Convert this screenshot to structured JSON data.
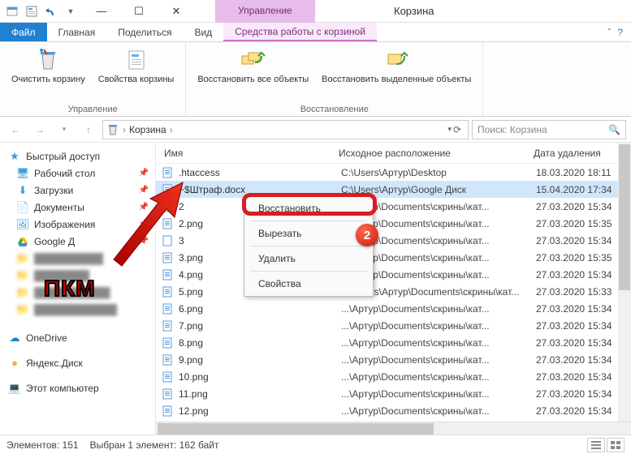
{
  "title": "Корзина",
  "tab_top": "Управление",
  "ribbon": {
    "file": "Файл",
    "tabs": [
      "Главная",
      "Поделиться",
      "Вид"
    ],
    "contextual": "Средства работы с корзиной",
    "group1": {
      "title": "Управление",
      "btn1": "Очистить корзину",
      "btn2": "Свойства корзины"
    },
    "group2": {
      "title": "Восстановление",
      "btn1": "Восстановить все объекты",
      "btn2": "Восстановить выделенные объекты"
    }
  },
  "breadcrumb": {
    "item": "Корзина"
  },
  "search": {
    "placeholder": "Поиск: Корзина"
  },
  "sidebar": {
    "quick": "Быстрый доступ",
    "items": [
      {
        "label": "Рабочий стол",
        "pinned": true
      },
      {
        "label": "Загрузки",
        "pinned": true
      },
      {
        "label": "Документы",
        "pinned": true
      },
      {
        "label": "Изображения",
        "pinned": true
      },
      {
        "label": "Google Д",
        "pinned": true
      }
    ],
    "onedrive": "OneDrive",
    "yandex": "Яндекс.Диск",
    "thispc": "Этот компьютер"
  },
  "columns": {
    "name": "Имя",
    "loc": "Исходное расположение",
    "date": "Дата удаления"
  },
  "files": [
    {
      "name": ".htaccess",
      "loc": "C:\\Users\\Артур\\Desktop",
      "date": "18.03.2020 18:11"
    },
    {
      "name": "~$Штраф.docx",
      "loc": "C:\\Users\\Артур\\Google Диск",
      "date": "15.04.2020 17:34",
      "selected": true
    },
    {
      "name": "2",
      "loc": "...\\Артур\\Documents\\скрины\\кат...",
      "date": "27.03.2020 15:34"
    },
    {
      "name": "2.png",
      "loc": "...\\Артур\\Documents\\скрины\\кат...",
      "date": "27.03.2020 15:35"
    },
    {
      "name": "3",
      "loc": "...\\Артур\\Documents\\скрины\\кат...",
      "date": "27.03.2020 15:34"
    },
    {
      "name": "3.png",
      "loc": "...\\Артур\\Documents\\скрины\\кат...",
      "date": "27.03.2020 15:35"
    },
    {
      "name": "4.png",
      "loc": "...\\Артур\\Documents\\скрины\\кат...",
      "date": "27.03.2020 15:34"
    },
    {
      "name": "5.png",
      "loc": "C:\\Users\\Артур\\Documents\\скрины\\кат...",
      "date": "27.03.2020 15:33"
    },
    {
      "name": "6.png",
      "loc": "...\\Артур\\Documents\\скрины\\кат...",
      "date": "27.03.2020 15:34"
    },
    {
      "name": "7.png",
      "loc": "...\\Артур\\Documents\\скрины\\кат...",
      "date": "27.03.2020 15:34"
    },
    {
      "name": "8.png",
      "loc": "...\\Артур\\Documents\\скрины\\кат...",
      "date": "27.03.2020 15:34"
    },
    {
      "name": "9.png",
      "loc": "...\\Артур\\Documents\\скрины\\кат...",
      "date": "27.03.2020 15:34"
    },
    {
      "name": "10.png",
      "loc": "...\\Артур\\Documents\\скрины\\кат...",
      "date": "27.03.2020 15:34"
    },
    {
      "name": "11.png",
      "loc": "...\\Артур\\Documents\\скрины\\кат...",
      "date": "27.03.2020 15:34"
    },
    {
      "name": "12.png",
      "loc": "...\\Артур\\Documents\\скрины\\кат...",
      "date": "27.03.2020 15:34"
    }
  ],
  "context_menu": {
    "restore": "Восстановить",
    "cut": "Вырезать",
    "delete": "Удалить",
    "properties": "Свойства"
  },
  "annotation": {
    "pkm": "ПКМ",
    "badge": "2"
  },
  "status": {
    "count": "Элементов: 151",
    "selected": "Выбран 1 элемент: 162 байт"
  }
}
